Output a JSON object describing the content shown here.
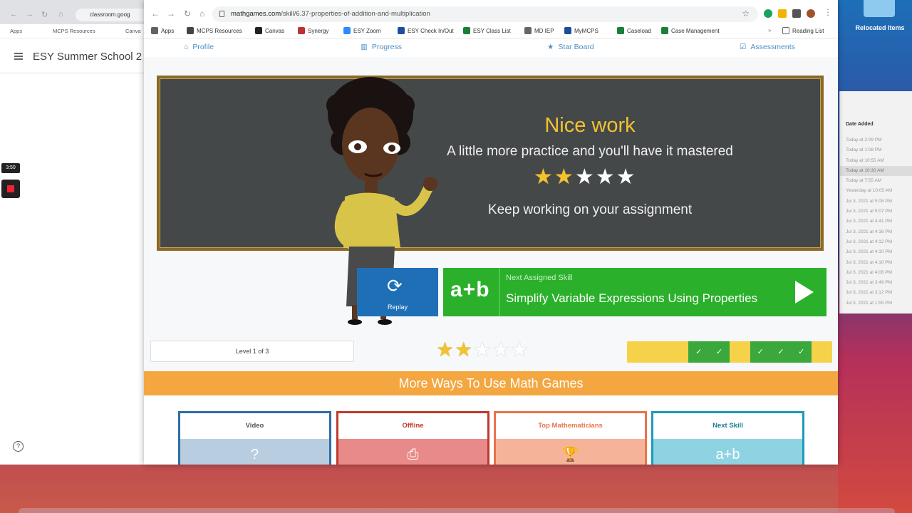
{
  "desktop": {
    "relocated_items_label": "Relocated Items",
    "finder": {
      "column_header": "Date Added",
      "rows": [
        "Today at 2:09 PM",
        "Today at 1:08 PM",
        "Today at 10:55 AM",
        "Today at 10:30 AM",
        "Today at 7:55 AM",
        "Yesterday at 10:05 AM",
        "Jul 3, 2021 at 5:08 PM",
        "Jul 3, 2021 at 5:07 PM",
        "Jul 3, 2021 at 4:41 PM",
        "Jul 3, 2021 at 4:16 PM",
        "Jul 3, 2021 at 4:12 PM",
        "Jul 3, 2021 at 4:10 PM",
        "Jul 3, 2021 at 4:10 PM",
        "Jul 3, 2021 at 4:06 PM",
        "Jul 3, 2021 at 3:49 PM",
        "Jul 3, 2021 at 3:12 PM",
        "Jul 3, 2021 at 1:55 PM"
      ]
    }
  },
  "recorder": {
    "time": "3:50"
  },
  "left_window": {
    "url": "classroom.goog",
    "bookmarks": [
      "Apps",
      "MCPS Resources",
      "Canva"
    ],
    "page_title": "ESY Summer School 2"
  },
  "browser": {
    "url_host": "mathgames.com",
    "url_path": "/skill/6.37-properties-of-addition-and-multiplication",
    "bookmarks": [
      {
        "label": "Apps",
        "color": "#5f6368"
      },
      {
        "label": "MCPS Resources",
        "color": "#444"
      },
      {
        "label": "Canvas",
        "color": "#222"
      },
      {
        "label": "Synergy",
        "color": "#b33"
      },
      {
        "label": "ESY Zoom",
        "color": "#2d8cff"
      },
      {
        "label": "ESY Check In/Out",
        "color": "#1a4fa0"
      },
      {
        "label": "ESY Class List",
        "color": "#188038"
      },
      {
        "label": "MD IEP",
        "color": "#666"
      },
      {
        "label": "MyMCPS",
        "color": "#1a4fa0"
      },
      {
        "label": "Caseload",
        "color": "#188038"
      },
      {
        "label": "Case Management",
        "color": "#188038"
      }
    ],
    "reading_list": "Reading List"
  },
  "site_nav": {
    "items": [
      {
        "label": "Profile",
        "icon": "home-icon"
      },
      {
        "label": "Progress",
        "icon": "bar-chart-icon"
      },
      {
        "label": "Star Board",
        "icon": "star-icon"
      },
      {
        "label": "Assessments",
        "icon": "checkbox-icon"
      }
    ]
  },
  "result": {
    "title": "Nice work",
    "subtitle": "A little more practice and you'll have it mastered",
    "stars_earned": 2,
    "stars_total": 5,
    "message": "Keep working on your assignment"
  },
  "actions": {
    "replay_label": "Replay",
    "next_icon_text": "a+b",
    "next_small": "Next Assigned Skill",
    "next_title": "Simplify Variable Expressions Using Properties"
  },
  "level": {
    "label": "Level 1 of 3",
    "stars_earned": 2,
    "stars_total": 5,
    "progress_tiles": [
      "pending",
      "pending",
      "pending",
      "done",
      "done",
      "pending",
      "done",
      "done",
      "done",
      "pending"
    ]
  },
  "more_ways": {
    "title": "More Ways To Use Math Games",
    "cards": [
      {
        "title": "Video",
        "icon": "video-icon",
        "glyph": "?",
        "border": "#2e6da4",
        "fg": "#555",
        "bg": "#b8cde0"
      },
      {
        "title": "Offline",
        "icon": "pdf-icon",
        "glyph": "⎙",
        "border": "#c0392b",
        "fg": "#c0392b",
        "bg": "#e88a8a"
      },
      {
        "title": "Top Mathematicians",
        "icon": "trophy-icon",
        "glyph": "🏆",
        "border": "#e8734a",
        "fg": "#e8734a",
        "bg": "#f5b49a"
      },
      {
        "title": "Next Skill",
        "icon": "a-plus-b-icon",
        "glyph": "a+b",
        "border": "#1a9bb8",
        "fg": "#1a7a94",
        "bg": "#8fd3e3"
      }
    ]
  },
  "colors": {
    "star_filled": "#f2c230",
    "star_empty": "#ffffff",
    "tile_done": "#3aa83a",
    "tile_pending": "#f6d24a",
    "accent_orange": "#f4a640"
  }
}
